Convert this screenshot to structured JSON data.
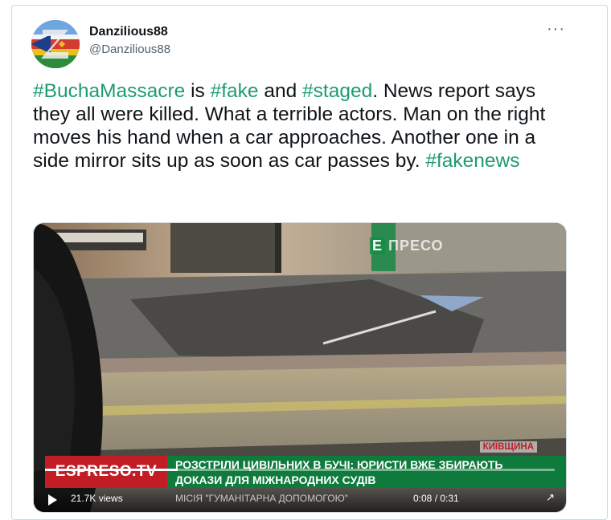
{
  "author": {
    "display_name": "Danzilious88",
    "handle": "@Danzilious88",
    "avatar_icon": "flag-collage-avatar"
  },
  "menu_icon": "more-horizontal-icon",
  "tweet": {
    "tag_color": "#1d9b74",
    "parts": [
      {
        "text": "#BuchaMassacre",
        "tag": true
      },
      {
        "text": " is ",
        "tag": false
      },
      {
        "text": "#fake",
        "tag": true
      },
      {
        "text": " and ",
        "tag": false
      },
      {
        "text": "#staged",
        "tag": true
      },
      {
        "text": ". News report says they all were killed.  What a terrible actors. Man on the right moves his hand when a car approaches. Another one in a side mirror sits up as soon as car passes by. ",
        "tag": false
      },
      {
        "text": "#fakenews",
        "tag": true
      }
    ]
  },
  "video": {
    "watermark_letter": "E",
    "watermark": "ПРЕСО",
    "region": "КИЇВЩИНА",
    "channel": "ESPRESO.TV",
    "headline_line1": "РОЗСТРІЛИ ЦИВІЛЬНИХ В БУЧІ: ЮРИСТИ ВЖЕ ЗБИРАЮТЬ",
    "headline_line2": "ДОКАЗИ ДЛЯ МІЖНАРОДНИХ СУДІВ",
    "ticker": "МІСІЯ \"ГУМАНІТАРНА ДОПОМОГОЮ\"",
    "views": "21.7K views",
    "timecode": "0:08 / 0:31",
    "progress": 0.26,
    "brand_red": "#c21d25",
    "brand_green": "#0e7b3c"
  }
}
